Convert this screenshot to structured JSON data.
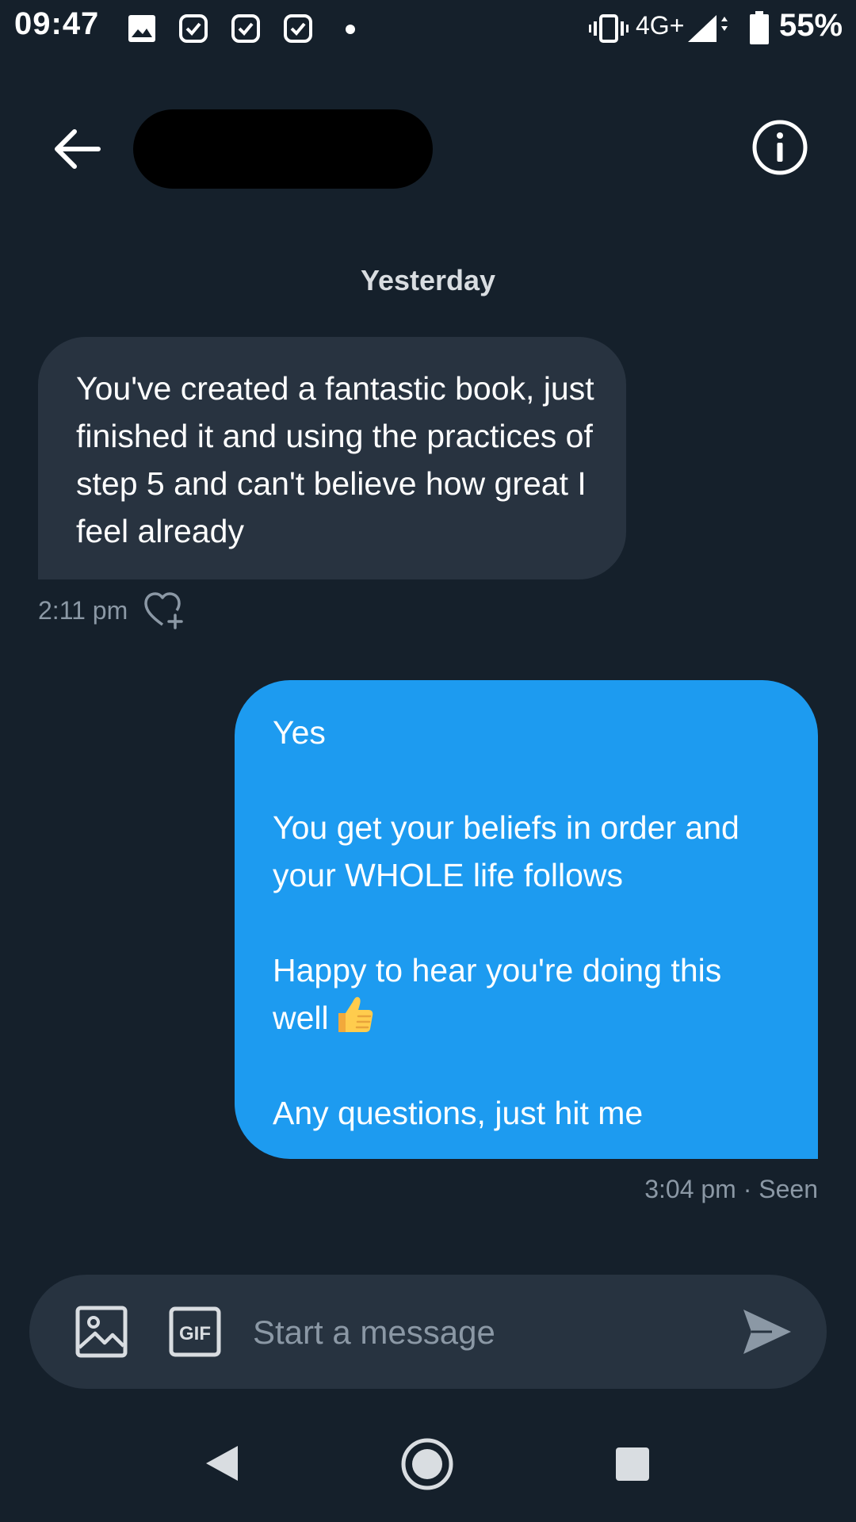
{
  "status_bar": {
    "time": "09:47",
    "network": "4G+",
    "battery": "55%",
    "icons": [
      "image-notification-icon",
      "check-notification-icon",
      "check-notification-icon",
      "check-notification-icon",
      "dot-icon",
      "vibrate-icon",
      "signal-icon",
      "battery-icon"
    ]
  },
  "header": {
    "back_icon": "arrow-left-icon",
    "contact_name": "",
    "info_icon": "info-icon"
  },
  "conversation": {
    "day_label": "Yesterday",
    "messages": [
      {
        "direction": "incoming",
        "text": "You've created a fantastic book, just finished it and using the practices of step 5 and can't believe how great I feel already",
        "time": "2:11 pm",
        "react_icon": "heart-add-icon"
      },
      {
        "direction": "outgoing",
        "paragraphs": [
          "Yes",
          "You get your beliefs in order and your WHOLE life follows",
          "Happy to hear you're doing this well",
          "Any questions, just hit me"
        ],
        "emoji_icon": "thumbs-up-icon",
        "meta": "3:04 pm · Seen"
      }
    ]
  },
  "composer": {
    "image_icon": "image-icon",
    "gif_label": "GIF",
    "placeholder": "Start a message",
    "value": "",
    "send_icon": "send-icon"
  },
  "colors": {
    "background": "#15202b",
    "incoming_bubble": "#283340",
    "outgoing_bubble": "#1d9bf0",
    "muted_text": "#8b98a5",
    "composer": "#273340"
  }
}
